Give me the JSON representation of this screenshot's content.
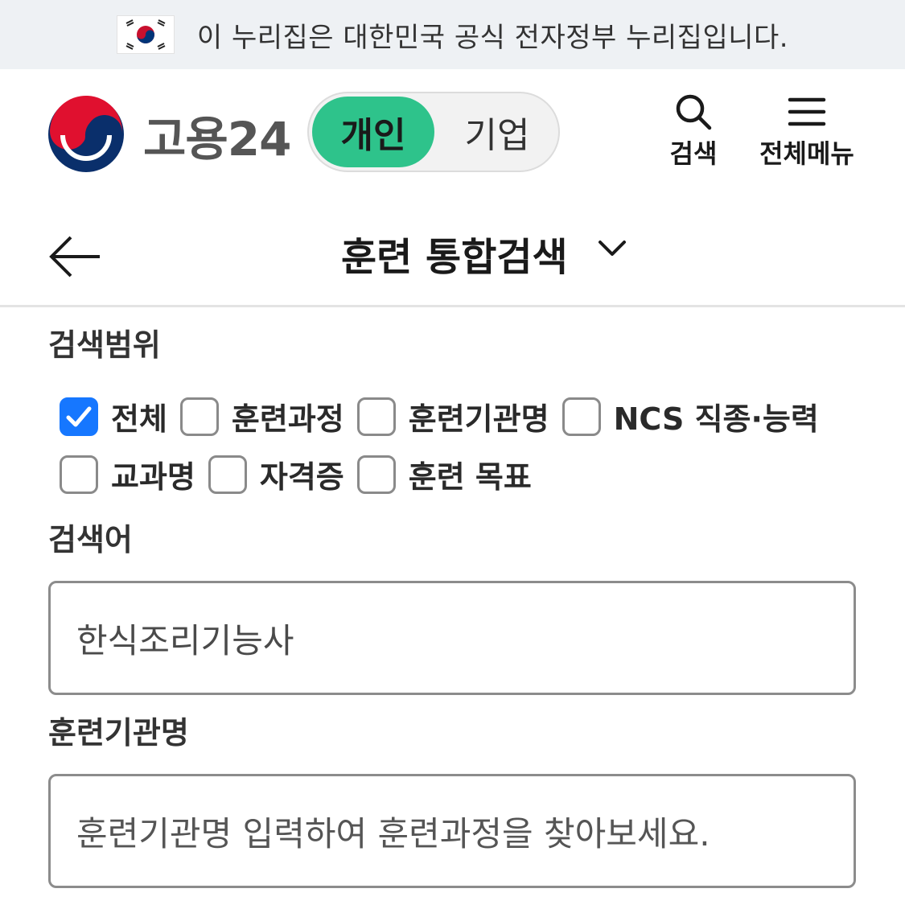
{
  "banner": {
    "text": "이 누리집은 대한민국 공식 전자정부 누리집입니다."
  },
  "header": {
    "logo_text": "고용24",
    "toggle": {
      "personal": "개인",
      "company": "기업"
    },
    "search_label": "검색",
    "menu_label": "전체메뉴"
  },
  "title_bar": {
    "title": "훈련 통합검색"
  },
  "search_scope": {
    "label": "검색범위",
    "options": [
      {
        "label": "전체",
        "checked": true
      },
      {
        "label": "훈련과정",
        "checked": false
      },
      {
        "label": "훈련기관명",
        "checked": false
      },
      {
        "label": "NCS 직종·능력",
        "checked": false
      },
      {
        "label": "교과명",
        "checked": false
      },
      {
        "label": "자격증",
        "checked": false
      },
      {
        "label": "훈련 목표",
        "checked": false
      }
    ]
  },
  "keyword": {
    "label": "검색어",
    "value": "한식조리기능사"
  },
  "institution": {
    "label": "훈련기관명",
    "placeholder": "훈련기관명 입력하여 훈련과정을 찾아보세요."
  },
  "colors": {
    "accent_green": "#2ec38b",
    "checkbox_blue": "#1677ff"
  }
}
